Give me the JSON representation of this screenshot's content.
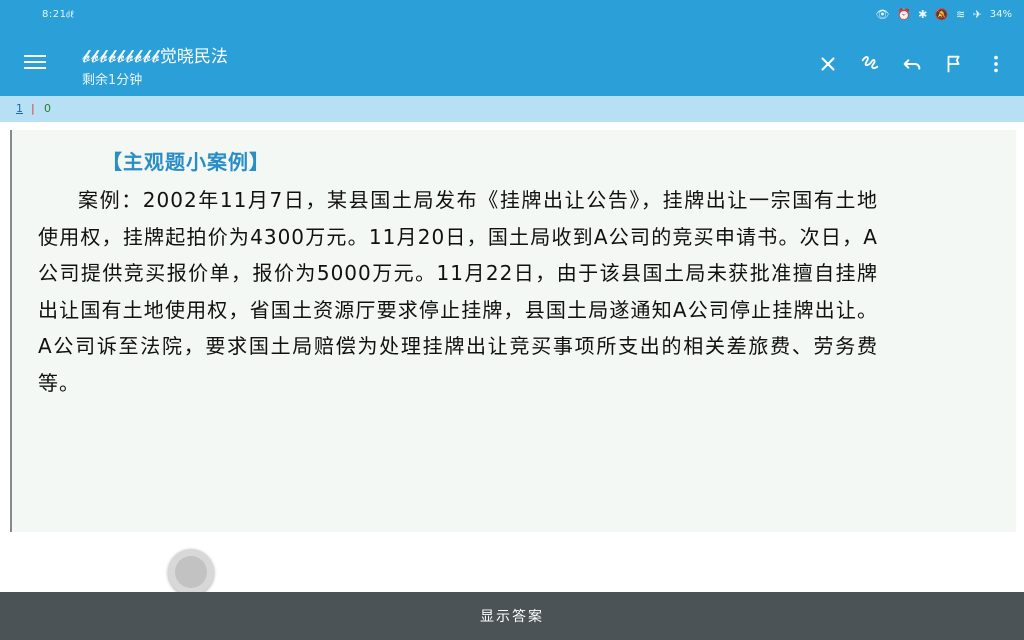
{
  "status_bar": {
    "time": "8:21",
    "sim": "㎗",
    "icons": "👁 ⏰ ✱ 🔕 ≋ ✈",
    "battery": "34%",
    "icon_names": [
      "eye-icon",
      "alarm-icon",
      "bluetooth-icon",
      "mute-icon",
      "wifi-icon",
      "airplane-icon",
      "battery-icon"
    ]
  },
  "app_bar": {
    "title": "𝓫𝓫𝓫𝓫𝓫𝓫𝓫𝓫𝓫觉晓民法",
    "subtitle": "剩余1分钟",
    "actions": [
      "close-icon",
      "scribble-icon",
      "undo-icon",
      "flag-icon",
      "more-vert-icon"
    ]
  },
  "progress": {
    "current": "1",
    "separator": "|",
    "total": "0"
  },
  "case": {
    "title": "【主观题小案例】",
    "body": "案例：2002年11月7日，某县国土局发布《挂牌出让公告》，挂牌出让一宗国有土地使用权，挂牌起拍价为4300万元。11月20日，国土局收到A公司的竞买申请书。次日，A公司提供竞买报价单，报价为5000万元。11月22日，由于该县国土局未获批准擅自挂牌出让国有土地使用权，省国土资源厅要求停止挂牌，县国土局遂通知A公司停止挂牌出让。A公司诉至法院，要求国土局赔偿为处理挂牌出让竞买事项所支出的相关差旅费、劳务费等。"
  },
  "bottom": {
    "show_answer_label": "显示答案"
  },
  "colors": {
    "primary": "#2a9fd8",
    "progress_bg": "#b7e0f5",
    "title_blue": "#2a8ec6",
    "bottom_bar": "#4c5356"
  }
}
